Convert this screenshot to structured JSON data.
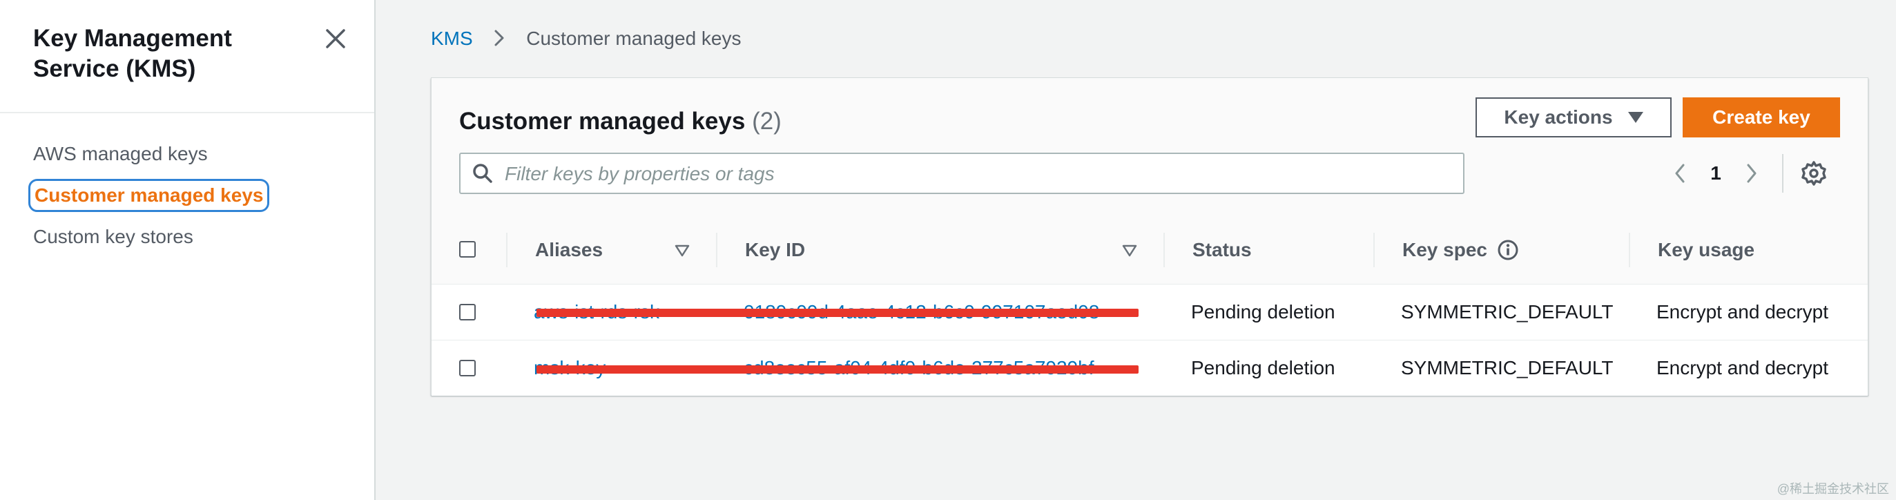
{
  "sidebar": {
    "title": "Key Management Service (KMS)",
    "items": [
      {
        "label": "AWS managed keys",
        "active": false
      },
      {
        "label": "Customer managed keys",
        "active": true
      },
      {
        "label": "Custom key stores",
        "active": false
      }
    ]
  },
  "breadcrumb": {
    "root": "KMS",
    "current": "Customer managed keys"
  },
  "panel": {
    "title": "Customer managed keys",
    "count": "(2)",
    "key_actions_label": "Key actions",
    "create_key_label": "Create key",
    "search_placeholder": "Filter keys by properties or tags",
    "page_number": "1"
  },
  "table": {
    "headers": {
      "aliases": "Aliases",
      "key_id": "Key ID",
      "status": "Status",
      "key_spec": "Key spec",
      "key_usage": "Key usage"
    },
    "rows": [
      {
        "alias": "aws-ist-rds-rsk",
        "key_id": "0189c09d-4aae-4c12-b6c0-997107aed08",
        "status": "Pending deletion",
        "key_spec": "SYMMETRIC_DEFAULT",
        "key_usage": "Encrypt and decrypt"
      },
      {
        "alias": "msk-key",
        "key_id": "cd8eec55-af04-4df0-b6de-277c5a7929bf",
        "status": "Pending deletion",
        "key_spec": "SYMMETRIC_DEFAULT",
        "key_usage": "Encrypt and decrypt"
      }
    ]
  },
  "watermark": "@稀土掘金技术社区",
  "colors": {
    "accent": "#ec7211",
    "link": "#0073bb",
    "focus": "#3184d6",
    "redaction": "#e8362a"
  },
  "icons": [
    "close-icon",
    "chevron-right-icon",
    "search-icon",
    "caret-down-icon",
    "chevron-left-icon",
    "settings-gear-icon",
    "sort-icon",
    "info-icon"
  ]
}
